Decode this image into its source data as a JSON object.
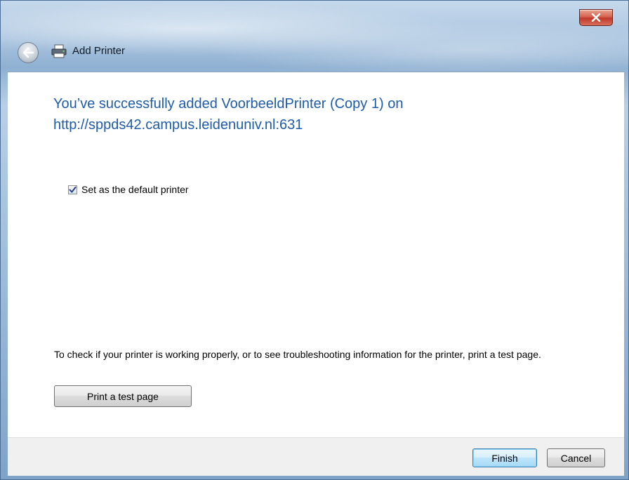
{
  "window": {
    "title": "Add Printer",
    "close_label": "X"
  },
  "content": {
    "headline_line1": "You’ve successfully added VoorbeeldPrinter (Copy 1) on",
    "headline_line2": "http://sppds42.campus.leidenuniv.nl:631",
    "default_printer": {
      "label": "Set as the default printer",
      "checked": true
    },
    "info_text": "To check if your printer is working properly, or to see troubleshooting information for the printer, print a test page.",
    "test_page_button": "Print a test page"
  },
  "footer": {
    "finish_label": "Finish",
    "cancel_label": "Cancel"
  },
  "colors": {
    "headline": "#1e5bab",
    "finish_border": "#3c7fb1"
  }
}
